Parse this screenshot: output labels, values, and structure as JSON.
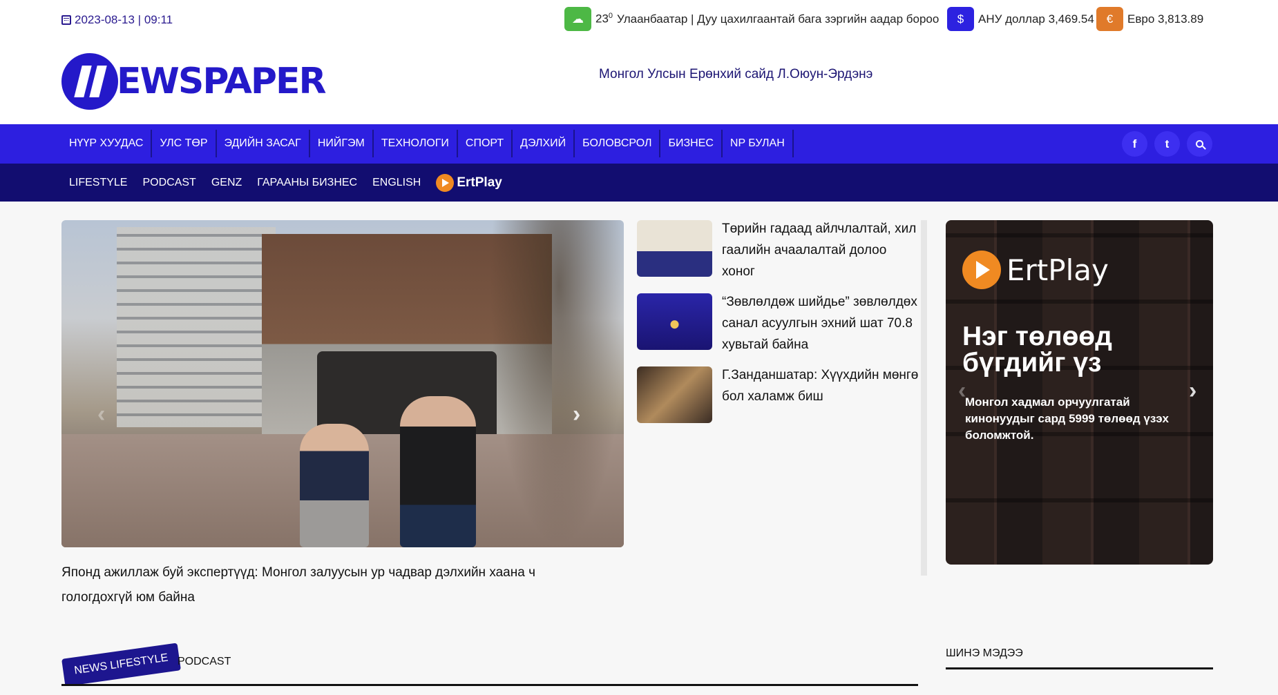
{
  "topbar": {
    "date": "2023-08-13 | 09:11",
    "weather": {
      "temp": "23",
      "temp_sup": "0",
      "text": "Улаанбаатар | Дуу цахилгаантай бага зэргийн аадар бороо"
    },
    "usd": {
      "symbol": "$",
      "text": "АНУ доллар 3,469.54"
    },
    "eur": {
      "symbol": "€",
      "text": "Евро 3,813.89"
    }
  },
  "header": {
    "logo_text": "EWSPAPER",
    "headline": "Монгол Улсын Ерөнхий сайд Л.Оюун-Эрдэнэ"
  },
  "nav_main": [
    "НҮҮР ХУУДАС",
    "УЛС ТӨР",
    "ЭДИЙН ЗАСАГ",
    "НИЙГЭМ",
    "ТЕХНОЛОГИ",
    "СПОРТ",
    "ДЭЛХИЙ",
    "БОЛОВСРОЛ",
    "БИЗНЕС",
    "NP БУЛАН"
  ],
  "nav_icons": {
    "facebook": "f",
    "twitter": "t"
  },
  "nav_sub": [
    "LIFESTYLE",
    "PODCAST",
    "GENZ",
    "ГАРААНЫ БИЗНЕС",
    "ENGLISH"
  ],
  "ertplay_label": "ErtPlay",
  "feature": {
    "caption": "Японд ажиллаж буй экспертүүд: Монгол залуусын ур чадвар дэлхийн хаана ч гологдохгүй юм байна"
  },
  "side_news": [
    "Төрийн гадаад айлчлалтай, хил гаалийн ачаалалтай долоо хоног",
    "“Зөвлөлдөж шийдье” зөвлөлдөх санал асуулгын эхний шат 70.8 хувьтай байна",
    "Г.Занданшатар: Хүүхдийн мөнгө бол халамж биш"
  ],
  "ad": {
    "brand": "ErtPlay",
    "headline": "Нэг төлөөд бүгдийг үз",
    "text": "Монгол хадмал орчуулгатай кинонуудыг сард 5999 төлөөд үзэх боломжтой."
  },
  "bottom": {
    "news_tab": "NEWS LIFESTYLE",
    "podcast_tab": "PODCAST",
    "latest": "ШИНЭ МЭДЭЭ"
  },
  "colors": {
    "primary": "#2d1fe0",
    "dark_nav": "#120d70",
    "accent_orange": "#f08a22",
    "weather_green": "#4db845"
  }
}
